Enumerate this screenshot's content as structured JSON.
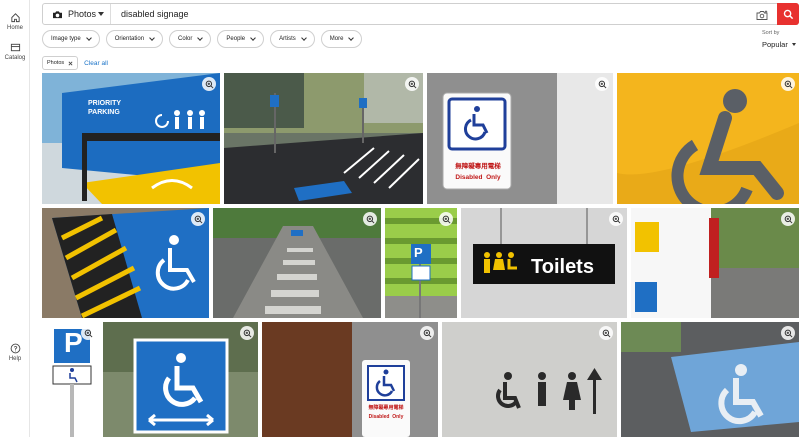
{
  "nav": {
    "home_label": "Home",
    "catalog_label": "Catalog",
    "help_label": "Help"
  },
  "search": {
    "media_type": "Photos",
    "query": "disabled signage"
  },
  "filters": [
    {
      "label": "Image type"
    },
    {
      "label": "Orientation"
    },
    {
      "label": "Color"
    },
    {
      "label": "People"
    },
    {
      "label": "Artists"
    },
    {
      "label": "More"
    }
  ],
  "sort": {
    "label": "Sort by",
    "value": "Popular"
  },
  "applied": {
    "pill_label": "Photos",
    "clear_label": "Clear all"
  },
  "images": {
    "priority_text": "PRIORITY\nPARKING",
    "chinese_text": "無障礙專用電梯",
    "disabled_only": "Disabled  Only",
    "toilets_text": "Toilets",
    "p_letter": "P"
  },
  "colors": {
    "accent": "#e8312f",
    "link": "#1a73c8",
    "sign_blue": "#1f6fc4"
  },
  "icons": [
    "home-icon",
    "catalog-icon",
    "help-icon",
    "camera-icon",
    "chevron-down-icon",
    "visual-search-icon",
    "search-icon",
    "close-icon",
    "zoom-icon"
  ]
}
